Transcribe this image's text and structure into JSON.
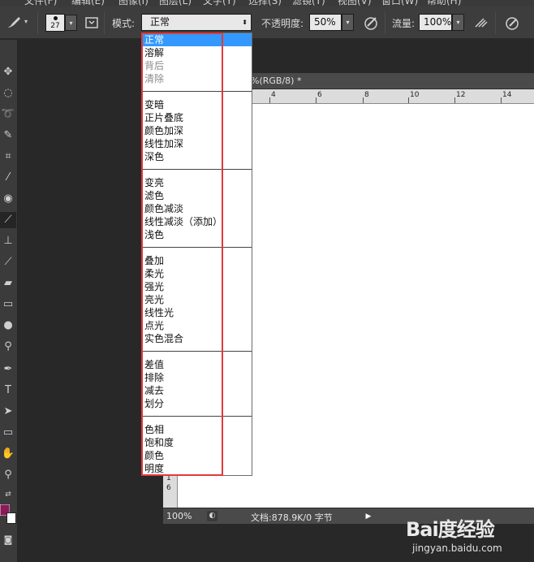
{
  "menubar": {
    "items": [
      "文件(F)",
      "编辑(E)",
      "图像(I)",
      "图层(L)",
      "文字(Y)",
      "选择(S)",
      "滤镜(T)",
      "视图(V)",
      "窗口(W)",
      "帮助(H)"
    ]
  },
  "options_bar": {
    "brush_size": "27",
    "mode_label": "模式:",
    "mode_value": "正常",
    "opacity_label": "不透明度:",
    "opacity_value": "50%",
    "flow_label": "流量:",
    "flow_value": "100%"
  },
  "document": {
    "tab_title": "%(RGB/8) *",
    "ruler_h": [
      "4",
      "6",
      "8",
      "10",
      "12",
      "14"
    ],
    "ruler_v": [
      "1",
      "6"
    ]
  },
  "status_bar": {
    "zoom": "100%",
    "doc_info": "文档:878.9K/0 字节"
  },
  "blend_mode_menu": {
    "groups": [
      {
        "items": [
          {
            "label": "正常",
            "selected": true
          },
          {
            "label": "溶解"
          },
          {
            "label": "背后",
            "disabled": true
          },
          {
            "label": "清除",
            "disabled": true
          }
        ]
      },
      {
        "items": [
          {
            "label": "变暗"
          },
          {
            "label": "正片叠底"
          },
          {
            "label": "颜色加深"
          },
          {
            "label": "线性加深"
          },
          {
            "label": "深色"
          }
        ]
      },
      {
        "items": [
          {
            "label": "变亮"
          },
          {
            "label": "滤色"
          },
          {
            "label": "颜色减淡"
          },
          {
            "label": "线性减淡（添加）"
          },
          {
            "label": "浅色"
          }
        ]
      },
      {
        "items": [
          {
            "label": "叠加"
          },
          {
            "label": "柔光"
          },
          {
            "label": "强光"
          },
          {
            "label": "亮光"
          },
          {
            "label": "线性光"
          },
          {
            "label": "点光"
          },
          {
            "label": "实色混合"
          }
        ]
      },
      {
        "items": [
          {
            "label": "差值"
          },
          {
            "label": "排除"
          },
          {
            "label": "减去"
          },
          {
            "label": "划分"
          }
        ]
      },
      {
        "items": [
          {
            "label": "色相"
          },
          {
            "label": "饱和度"
          },
          {
            "label": "颜色"
          },
          {
            "label": "明度"
          }
        ]
      }
    ]
  },
  "colors": {
    "foreground": "#8a1a5a",
    "background": "#ffffff",
    "selection": "#3399ff",
    "highlight_box": "#e03a3a"
  },
  "watermark": {
    "logo": "Bai度经验",
    "url": "jingyan.baidu.com"
  }
}
